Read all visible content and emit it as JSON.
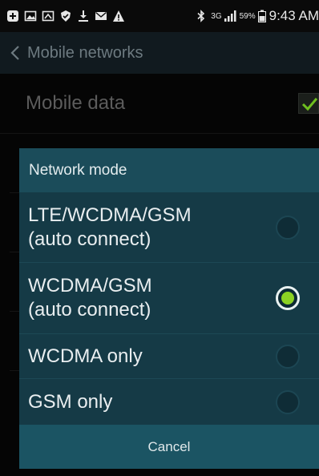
{
  "status_bar": {
    "left_icons": [
      "plus-icon",
      "gallery-icon",
      "screenshot-icon",
      "shield-icon",
      "download-icon",
      "mail-icon",
      "warning-icon"
    ],
    "bluetooth_icon": "bluetooth-icon",
    "network_type": "3G",
    "signal_icon": "signal-icon",
    "battery_percent": "59%",
    "battery_icon": "battery-icon",
    "time": "9:43 AM"
  },
  "action_bar": {
    "back_icon": "chevron-left-icon",
    "title": "Mobile networks"
  },
  "settings": {
    "mobile_data_label": "Mobile data",
    "mobile_data_checked": true
  },
  "dialog": {
    "title": "Network mode",
    "options": [
      {
        "label": "LTE/WCDMA/GSM\n(auto connect)",
        "selected": false
      },
      {
        "label": "WCDMA/GSM\n(auto connect)",
        "selected": true
      },
      {
        "label": "WCDMA only",
        "selected": false
      },
      {
        "label": "GSM only",
        "selected": false
      }
    ],
    "cancel_label": "Cancel"
  },
  "colors": {
    "dialog_bg": "#153a46",
    "dialog_header": "#1b4c5a",
    "cancel_bg": "#1b5463",
    "accent_green": "#8bd223",
    "check_green": "#6fbf1f"
  }
}
